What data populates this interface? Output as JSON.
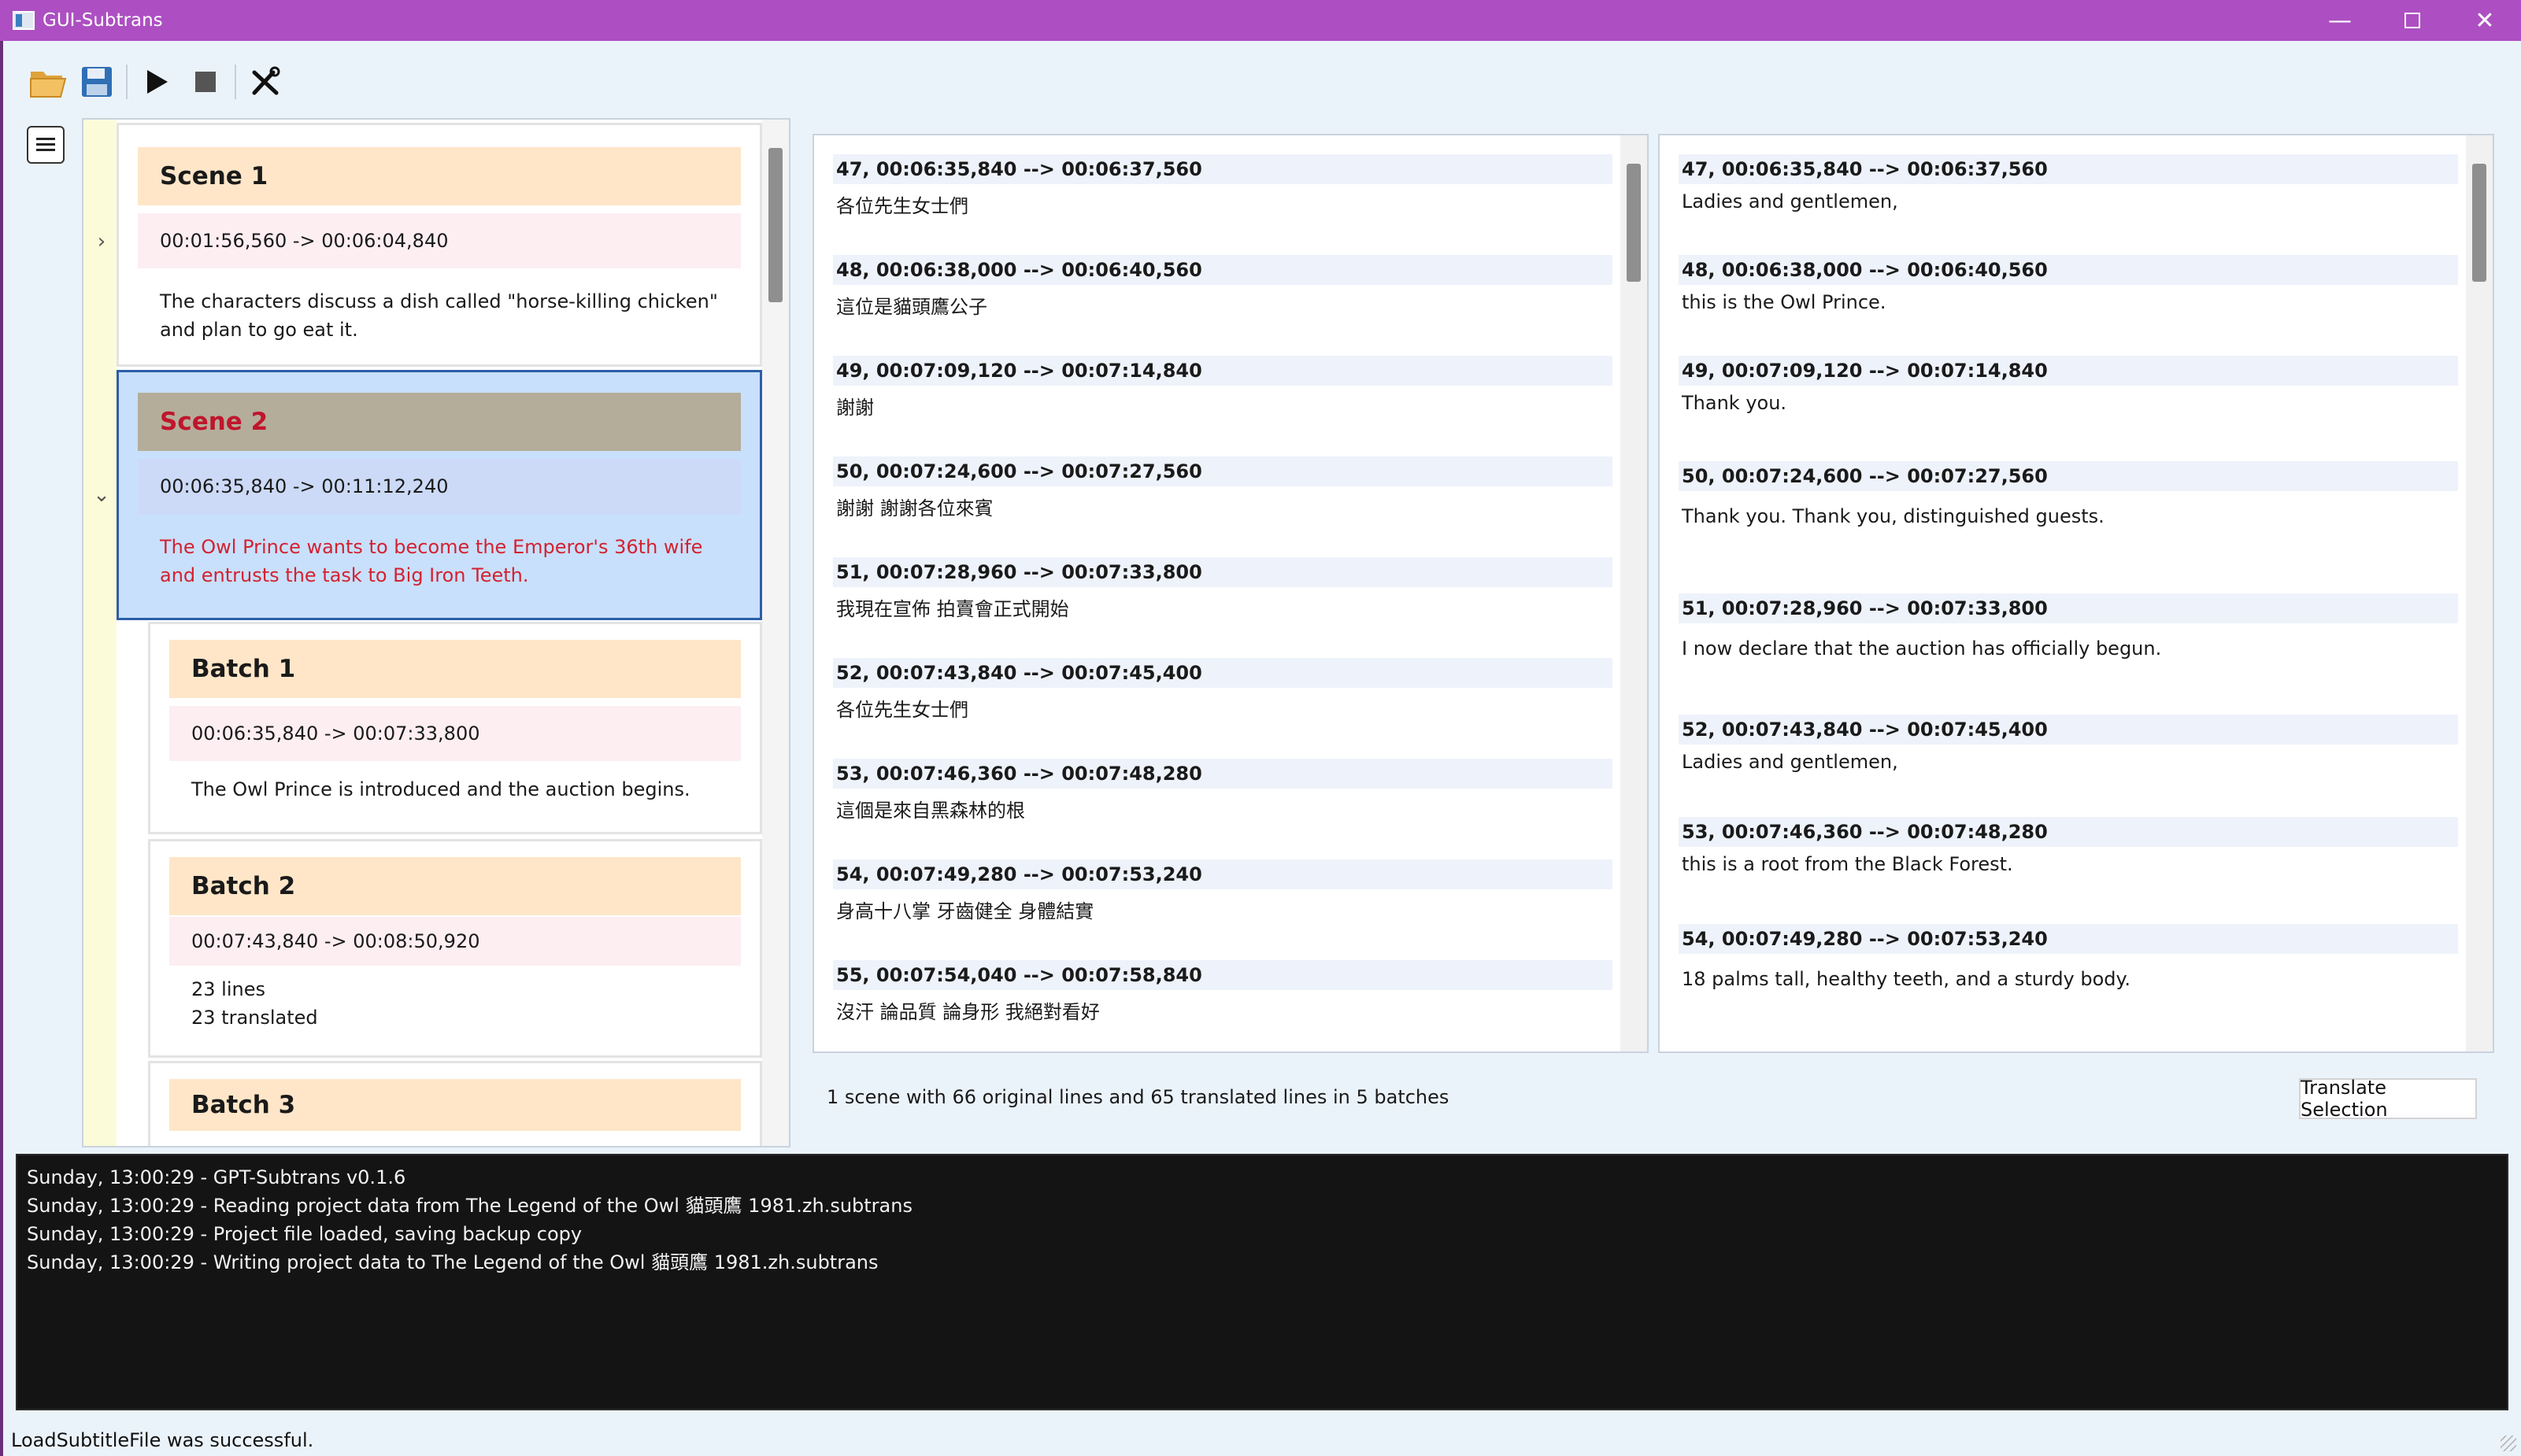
{
  "window": {
    "title": "GUI-Subtrans",
    "controls": {
      "minimize": "—",
      "close": "✕"
    }
  },
  "toolbar": {
    "buttons": [
      "open-icon",
      "save-icon",
      "play-icon",
      "stop-icon",
      "tools-icon"
    ]
  },
  "tree": {
    "expanders": {
      "collapsed": "›",
      "expanded": "⌄"
    },
    "scenes": [
      {
        "title": "Scene 1",
        "time": "00:01:56,560 -> 00:06:04,840",
        "description": "The characters discuss a dish called \"horse-killing chicken\" and plan to go eat it."
      },
      {
        "title": "Scene 2",
        "time": "00:06:35,840 -> 00:11:12,240",
        "description": "The Owl Prince wants to become the Emperor's 36th wife and entrusts the task to Big Iron Teeth."
      }
    ],
    "batches": [
      {
        "title": "Batch 1",
        "time": "00:06:35,840 -> 00:07:33,800",
        "description": "The Owl Prince is introduced and the auction begins."
      },
      {
        "title": "Batch 2",
        "time": "00:07:43,840 -> 00:08:50,920",
        "line1": "23 lines",
        "line2": "23 translated"
      },
      {
        "title": "Batch 3"
      }
    ]
  },
  "original": [
    {
      "header": "47, 00:06:35,840 --> 00:06:37,560",
      "text": "各位先生女士們"
    },
    {
      "header": "48, 00:06:38,000 --> 00:06:40,560",
      "text": "這位是貓頭鷹公子"
    },
    {
      "header": "49, 00:07:09,120 --> 00:07:14,840",
      "text": "謝謝"
    },
    {
      "header": "50, 00:07:24,600 --> 00:07:27,560",
      "text": "謝謝 謝謝各位來賓"
    },
    {
      "header": "51, 00:07:28,960 --> 00:07:33,800",
      "text": "我現在宣佈 拍賣會正式開始"
    },
    {
      "header": "52, 00:07:43,840 --> 00:07:45,400",
      "text": "各位先生女士們"
    },
    {
      "header": "53, 00:07:46,360 --> 00:07:48,280",
      "text": "這個是來自黑森林的根"
    },
    {
      "header": "54, 00:07:49,280 --> 00:07:53,240",
      "text": "身高十八掌 牙齒健全 身體結實"
    },
    {
      "header": "55, 00:07:54,040 --> 00:07:58,840",
      "text": "沒汗 論品質 論身形 我絕對看好"
    }
  ],
  "translated": [
    {
      "header": "47, 00:06:35,840 --> 00:06:37,560",
      "text": "Ladies and gentlemen,"
    },
    {
      "header": "48, 00:06:38,000 --> 00:06:40,560",
      "text": "this is the Owl Prince."
    },
    {
      "header": "49, 00:07:09,120 --> 00:07:14,840",
      "text": "Thank you."
    },
    {
      "header": "50, 00:07:24,600 --> 00:07:27,560",
      "text": "Thank you. Thank you, distinguished guests."
    },
    {
      "header": "51, 00:07:28,960 --> 00:07:33,800",
      "text": "I now declare that the auction has officially begun."
    },
    {
      "header": "52, 00:07:43,840 --> 00:07:45,400",
      "text": "Ladies and gentlemen,"
    },
    {
      "header": "53, 00:07:46,360 --> 00:07:48,280",
      "text": "this is a root from the Black Forest."
    },
    {
      "header": "54, 00:07:49,280 --> 00:07:53,240",
      "text": "18 palms tall, healthy teeth, and a sturdy body."
    }
  ],
  "summary": "1 scene with 66 original lines and 65 translated lines in 5 batches",
  "translate_button": "Translate Selection",
  "log": [
    "Sunday, 13:00:29 - GPT-Subtrans v0.1.6",
    "Sunday, 13:00:29 - Reading project data from The Legend of the Owl 貓頭鷹 1981.zh.subtrans",
    "Sunday, 13:00:29 - Project file loaded, saving backup copy",
    "Sunday, 13:00:29 - Writing project data to The Legend of the Owl 貓頭鷹 1981.zh.subtrans"
  ],
  "status": "LoadSubtitleFile was successful."
}
